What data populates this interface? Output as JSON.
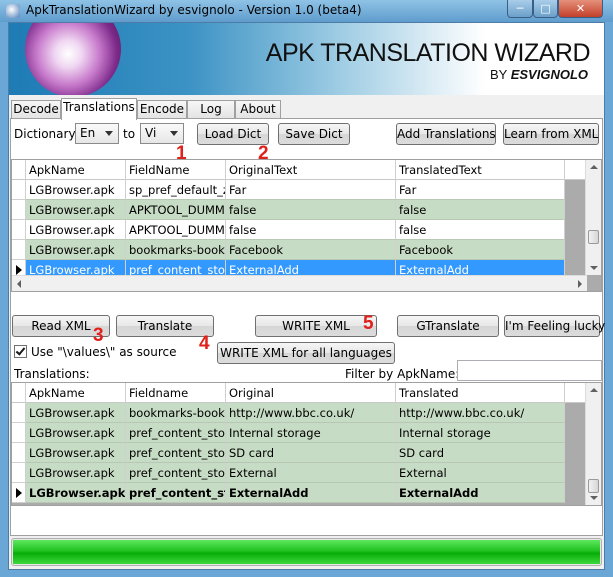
{
  "window": {
    "title": "ApkTranslationWizard by esvignolo - Version 1.0 (beta4)",
    "min_icon": "minimize-icon",
    "max_icon": "maximize-icon",
    "close_icon": "close-icon"
  },
  "banner": {
    "title": "APK TRANSLATION WIZARD",
    "by": "BY",
    "author": "ESVIGNOLO"
  },
  "tabs": [
    {
      "label": "Decode"
    },
    {
      "label": "Translations"
    },
    {
      "label": "Encode"
    },
    {
      "label": "Log"
    },
    {
      "label": "About"
    }
  ],
  "toolbar": {
    "dictionary_label": "Dictionary:",
    "from_lang": "En",
    "to_label": "to",
    "to_lang": "Vi",
    "load_dict": "Load Dict",
    "save_dict": "Save Dict",
    "add_translations": "Add Translations",
    "learn_from_xml": "Learn from XML"
  },
  "top_grid": {
    "headers": [
      "ApkName",
      "FieldName",
      "OriginalText",
      "TranslatedText"
    ],
    "rows": [
      {
        "apk": "LGBrowser.apk",
        "field": "sp_pref_default_zo",
        "original": "Far",
        "translated": "Far"
      },
      {
        "apk": "LGBrowser.apk",
        "field": "APKTOOL_DUMM",
        "original": "false",
        "translated": "false"
      },
      {
        "apk": "LGBrowser.apk",
        "field": "APKTOOL_DUMM",
        "original": "false",
        "translated": "false"
      },
      {
        "apk": "LGBrowser.apk",
        "field": "bookmarks-bookm",
        "original": "Facebook",
        "translated": "Facebook"
      },
      {
        "apk": "LGBrowser.apk",
        "field": "pref_content_stor",
        "original": "ExternalAdd",
        "translated": "ExternalAdd"
      }
    ]
  },
  "actions": {
    "read_xml": "Read XML",
    "translate": "Translate",
    "write_xml": "WRITE XML",
    "gtranslate": "GTranslate",
    "feeling_lucky": "I'm Feeling lucky",
    "use_values_label": "Use \"\\values\\\" as source",
    "write_xml_all": "WRITE XML for all languages",
    "translations_label": "Translations:",
    "filter_label": "Filter by ApkName:",
    "filter_value": ""
  },
  "annotations": [
    "1",
    "2",
    "3",
    "4",
    "5"
  ],
  "bottom_grid": {
    "headers": [
      "ApkName",
      "Fieldname",
      "Original",
      "Translated"
    ],
    "rows": [
      {
        "apk": "LGBrowser.apk",
        "field": "bookmarks-bookm",
        "original": "http://www.bbc.co.uk/",
        "translated": "http://www.bbc.co.uk/"
      },
      {
        "apk": "LGBrowser.apk",
        "field": "pref_content_stor",
        "original": "Internal storage",
        "translated": "Internal storage"
      },
      {
        "apk": "LGBrowser.apk",
        "field": "pref_content_stor",
        "original": "SD card",
        "translated": "SD card"
      },
      {
        "apk": "LGBrowser.apk",
        "field": "pref_content_stor",
        "original": "External",
        "translated": "External"
      },
      {
        "apk": "LGBrowser.apk",
        "field": "pref_content_sto",
        "original": "ExternalAdd",
        "translated": "ExternalAdd"
      }
    ]
  },
  "progress": {
    "value": 1.0,
    "color": "#21c221"
  }
}
